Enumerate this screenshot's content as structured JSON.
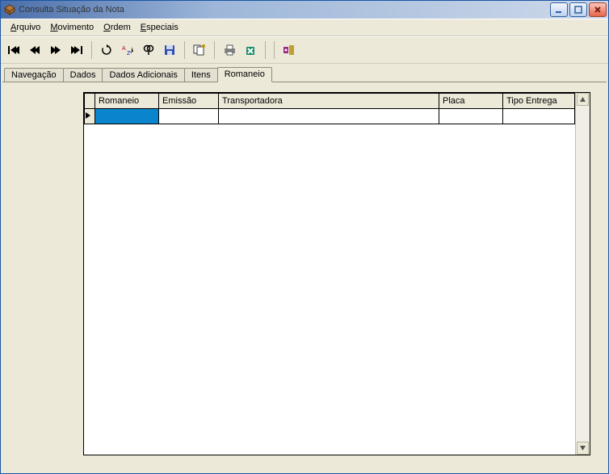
{
  "window": {
    "title": "Consulta Situação da Nota"
  },
  "menu": {
    "arquivo": "Arquivo",
    "movimento": "Movimento",
    "ordem": "Ordem",
    "especiais": "Especiais"
  },
  "toolbar": {
    "first": "Primeiro",
    "prev": "Anterior",
    "next": "Próximo",
    "last": "Último",
    "refresh": "Atualizar",
    "sort": "Ordenar",
    "find": "Localizar",
    "save": "Salvar",
    "copy": "Copiar",
    "print": "Imprimir",
    "delete": "Excluir",
    "tool": "Ferramenta"
  },
  "tabs": {
    "navegacao": "Navegação",
    "dados": "Dados",
    "dados_adicionais": "Dados Adicionais",
    "itens": "Itens",
    "romaneio": "Romaneio",
    "active": "romaneio"
  },
  "grid": {
    "columns": {
      "romaneio": "Romaneio",
      "emissao": "Emissão",
      "transportadora": "Transportadora",
      "placa": "Placa",
      "tipo_entrega": "Tipo Entrega"
    },
    "rows": [
      {
        "romaneio": "",
        "emissao": "",
        "transportadora": "",
        "placa": "",
        "tipo_entrega": ""
      }
    ]
  }
}
